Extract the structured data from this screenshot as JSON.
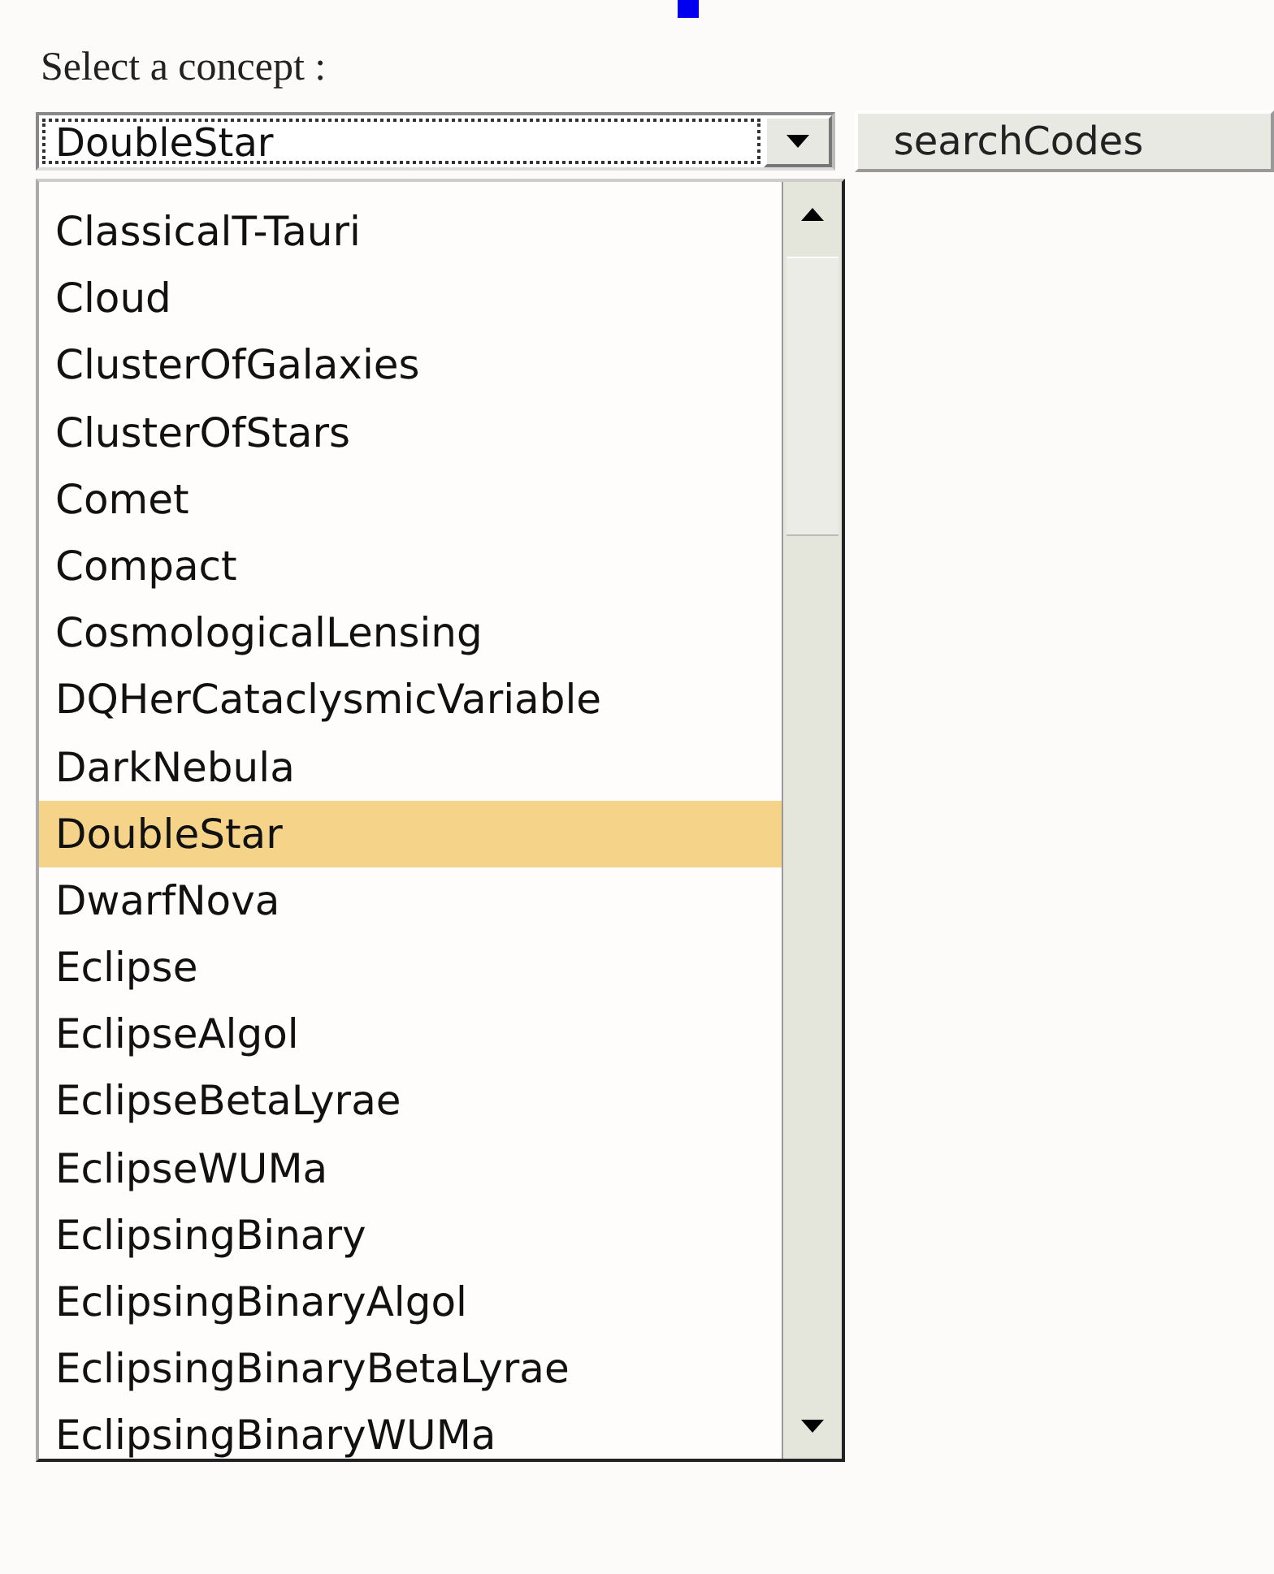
{
  "label": "Select a concept :",
  "select": {
    "value": "DoubleStar"
  },
  "button": "searchCodes",
  "options": [
    {
      "label": "ClassicalT-Tauri",
      "selected": false
    },
    {
      "label": "Cloud",
      "selected": false
    },
    {
      "label": "ClusterOfGalaxies",
      "selected": false
    },
    {
      "label": "ClusterOfStars",
      "selected": false
    },
    {
      "label": "Comet",
      "selected": false
    },
    {
      "label": "Compact",
      "selected": false
    },
    {
      "label": "CosmologicalLensing",
      "selected": false
    },
    {
      "label": "DQHerCataclysmicVariable",
      "selected": false
    },
    {
      "label": "DarkNebula",
      "selected": false
    },
    {
      "label": "DoubleStar",
      "selected": true
    },
    {
      "label": "DwarfNova",
      "selected": false
    },
    {
      "label": "Eclipse",
      "selected": false
    },
    {
      "label": "EclipseAlgol",
      "selected": false
    },
    {
      "label": "EclipseBetaLyrae",
      "selected": false
    },
    {
      "label": "EclipseWUMa",
      "selected": false
    },
    {
      "label": "EclipsingBinary",
      "selected": false
    },
    {
      "label": "EclipsingBinaryAlgol",
      "selected": false
    },
    {
      "label": "EclipsingBinaryBetaLyrae",
      "selected": false
    },
    {
      "label": "EclipsingBinaryWUMa",
      "selected": false
    }
  ]
}
